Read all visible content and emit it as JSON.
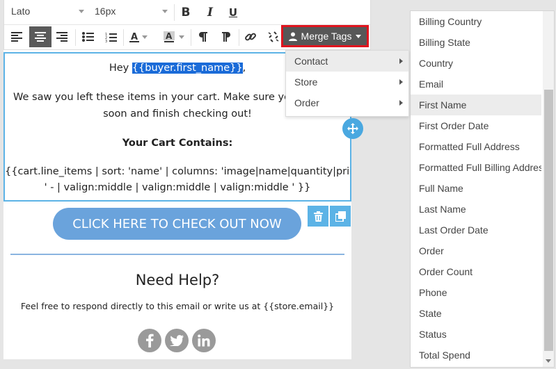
{
  "toolbar": {
    "font_family": "Lato",
    "font_size": "16px",
    "bold_label": "B",
    "italic_label": "I",
    "underline_label": "U",
    "merge_tags_label": "Merge Tags"
  },
  "merge_menu": {
    "items": [
      {
        "label": "Contact"
      },
      {
        "label": "Store"
      },
      {
        "label": "Order"
      }
    ]
  },
  "text_block": {
    "greeting_prefix": "Hey ",
    "greeting_tag": "{{buyer.first_name}}",
    "greeting_suffix": ",",
    "line1": "We saw you left these items in your cart. Make sure you s",
    "line2": "soon and finish checking out!",
    "cart_heading": "Your Cart Contains:",
    "cart_code_line1": "{{cart.line_items | sort: 'name' | columns: 'image|name|quantity|price',",
    "cart_code_line2": "' - | valign:middle | valign:middle | valign:middle ' }}"
  },
  "cta": {
    "label": "CLICK HERE TO CHECK OUT NOW"
  },
  "help": {
    "title": "Need Help?",
    "text": "Feel free to respond directly to this email or write us at {{store.email}}"
  },
  "fields": {
    "items": [
      "Billing Country",
      "Billing State",
      "Country",
      "Email",
      "First Name",
      "First Order Date",
      "Formatted Full Address",
      "Formatted Full Billing Address",
      "Full Name",
      "Last Name",
      "Last Order Date",
      "Order",
      "Order Count",
      "Phone",
      "State",
      "Status",
      "Total Spend"
    ],
    "highlighted": "First Name"
  },
  "colors": {
    "accent": "#5cb3e6",
    "cta": "#6aa3dc",
    "merge_button": "#575757",
    "merge_border": "#e0141e",
    "selection": "#1a6bd8"
  }
}
